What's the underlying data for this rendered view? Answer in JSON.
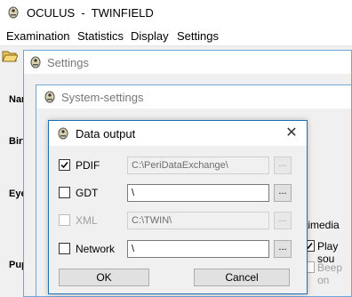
{
  "main_window": {
    "title": "OCULUS  -  TWINFIELD",
    "menu": [
      "Examination",
      "Statistics",
      "Display",
      "Settings"
    ],
    "side_labels": [
      "Nar",
      "Birt",
      "Eye",
      "Pup"
    ]
  },
  "settings_window": {
    "title": "Settings"
  },
  "system_settings_window": {
    "title": "System-settings",
    "multimedia_label": "timedia",
    "play_sound_label": "Play sou",
    "beep_label": "Beep on"
  },
  "dialog": {
    "title": "Data output",
    "close_glyph": "✕",
    "rows": [
      {
        "label": "PDIF",
        "checked": true,
        "enabled": true,
        "path": "C:\\PeriDataExchange\\",
        "path_enabled": false,
        "browse": "..."
      },
      {
        "label": "GDT",
        "checked": false,
        "enabled": true,
        "path": "\\",
        "path_enabled": true,
        "browse": "..."
      },
      {
        "label": "XML",
        "checked": false,
        "enabled": false,
        "path": "C:\\TWIN\\",
        "path_enabled": false,
        "browse": "..."
      },
      {
        "label": "Network",
        "checked": false,
        "enabled": true,
        "path": "\\",
        "path_enabled": true,
        "browse": "..."
      }
    ],
    "ok_label": "OK",
    "cancel_label": "Cancel"
  },
  "colors": {
    "accent": "#1f6fb7",
    "window_border": "#6fa6d6",
    "background": "#f0f0f0"
  }
}
